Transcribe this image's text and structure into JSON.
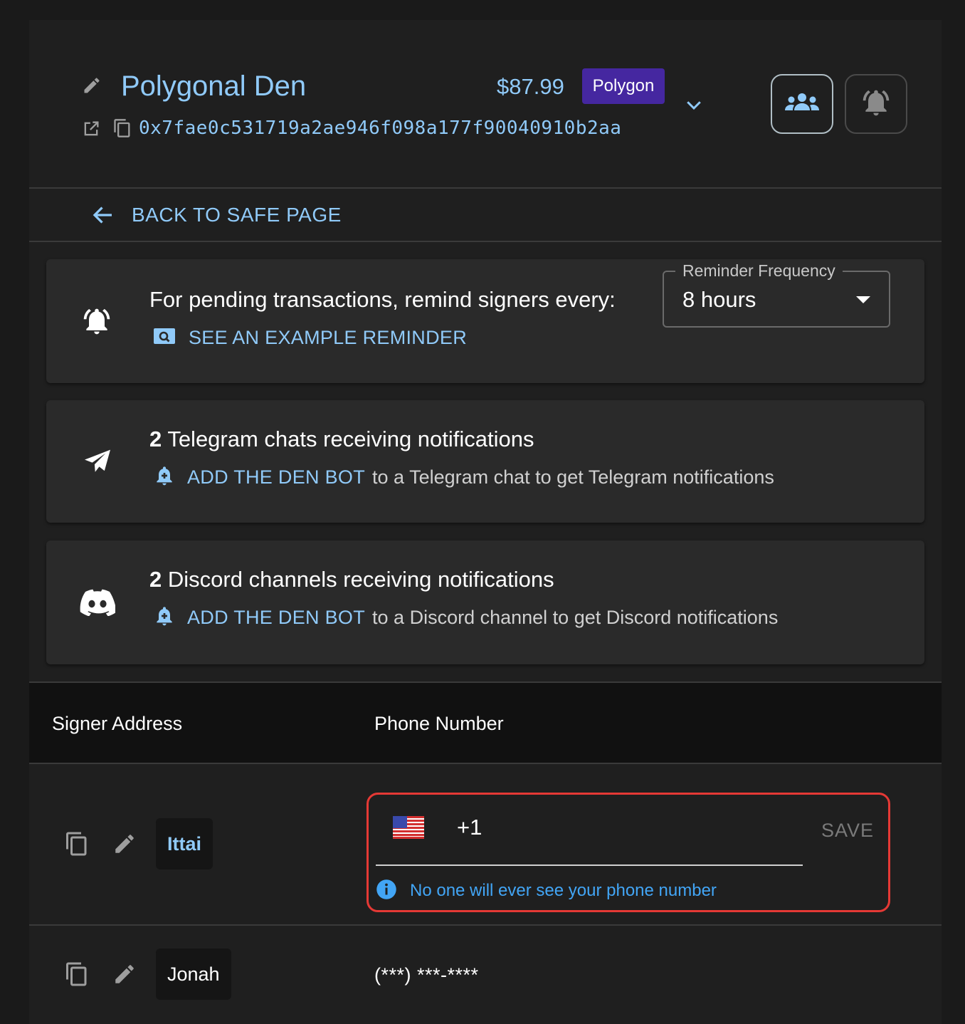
{
  "header": {
    "safe_name": "Polygonal Den",
    "balance": "$87.99",
    "chain": "Polygon",
    "address": "0x7fae0c531719a2ae946f098a177f90040910b2aa"
  },
  "nav": {
    "back_label": "BACK TO SAFE PAGE"
  },
  "reminder": {
    "prompt": "For pending transactions, remind signers every:",
    "example_link": "SEE AN EXAMPLE REMINDER",
    "frequency_label": "Reminder Frequency",
    "frequency_value": "8 hours"
  },
  "telegram": {
    "count": "2",
    "title": "Telegram chats receiving notifications",
    "link": "ADD THE DEN BOT",
    "suffix": "to a Telegram chat to get Telegram notifications"
  },
  "discord": {
    "count": "2",
    "title": "Discord channels receiving notifications",
    "link": "ADD THE DEN BOT",
    "suffix": "to a Discord channel to get Discord notifications"
  },
  "table": {
    "col_signer": "Signer Address",
    "col_phone": "Phone Number",
    "rows": [
      {
        "name": "Ittai",
        "dial_code": "+1",
        "save_label": "SAVE",
        "helper": "No one will ever see your phone number"
      },
      {
        "name": "Jonah",
        "phone_masked": "(***) ***-****"
      }
    ]
  },
  "colors": {
    "accent": "#90caf9",
    "badge": "#4527a0",
    "error_border": "#e53935",
    "info": "#42a5f5"
  }
}
